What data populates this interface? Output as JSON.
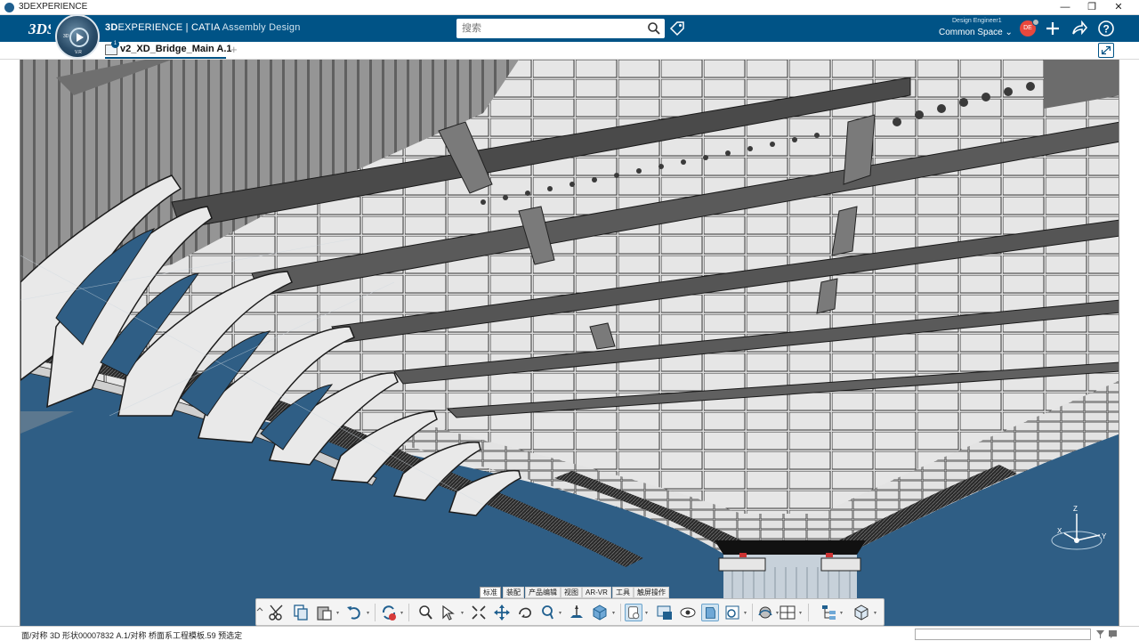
{
  "window": {
    "title": "3DEXPERIENCE",
    "minimize": "—",
    "restore": "❐",
    "close": "✕"
  },
  "topbar": {
    "brand_bold": "3D",
    "brand_main": "EXPERIENCE | CATIA",
    "brand_app": "Assembly Design",
    "search": {
      "placeholder": "搜索",
      "value": ""
    },
    "role": "Design Engineer1",
    "space": "Common Space ⌄",
    "avatar_initials": "DE",
    "colors": {
      "bar": "#005386",
      "avatar": "#e8483d"
    },
    "icons": [
      "tag-icon",
      "plus-icon",
      "share-icon",
      "help-icon"
    ]
  },
  "compass": {
    "labels": [
      "3D",
      "V.R"
    ]
  },
  "tabs": {
    "document": "v2_XD_Bridge_Main A.1",
    "badge": "1",
    "add": "+"
  },
  "viewport": {
    "background": "#2f5e85",
    "axes": {
      "x": "X",
      "y": "Y",
      "z": "Z"
    }
  },
  "action_bar": {
    "sections": [
      {
        "label": "标准",
        "active": true
      },
      {
        "label": "装配",
        "active": false
      },
      {
        "label": "产品编辑",
        "active": false
      },
      {
        "label": "视图",
        "active": false
      },
      {
        "label": "AR-VR",
        "active": false
      },
      {
        "label": "工具",
        "active": false
      },
      {
        "label": "触屏操作",
        "active": false
      }
    ],
    "tools": [
      "cut-icon",
      "copy-icon",
      "paste-icon",
      "undo-icon",
      "update-icon",
      "zoom-icon",
      "select-icon",
      "fit-all-icon",
      "pan-icon",
      "rotate-icon",
      "zoom-area-icon",
      "normal-view-icon",
      "iso-view-icon",
      "render-style-icon",
      "hide-show-icon",
      "swap-visible-icon",
      "capture-icon",
      "sections-icon",
      "ambient-icon",
      "multi-view-icon",
      "tree-icon",
      "3d-box-icon"
    ]
  },
  "statusbar": {
    "text": "面/对称 3D 形状00007832 A.1/对称 桥面系工程模板.59 预选定"
  }
}
